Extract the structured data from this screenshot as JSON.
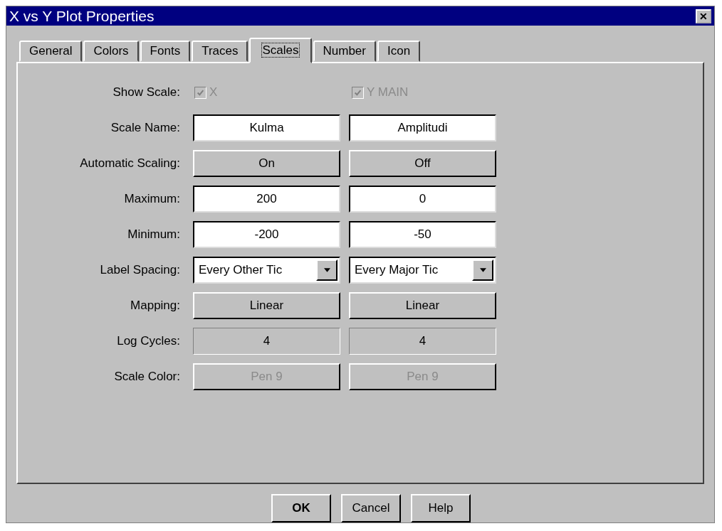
{
  "window": {
    "title": "X vs Y Plot Properties",
    "close": "✕"
  },
  "tabs": [
    {
      "label": "General",
      "selected": false
    },
    {
      "label": "Colors",
      "selected": false
    },
    {
      "label": "Fonts",
      "selected": false
    },
    {
      "label": "Traces",
      "selected": false
    },
    {
      "label": "Scales",
      "selected": true
    },
    {
      "label": "Number",
      "selected": false
    },
    {
      "label": "Icon",
      "selected": false
    }
  ],
  "rows": [
    {
      "label": "Show Scale:",
      "kind": "checkbox",
      "cells": [
        {
          "text": "X",
          "checked": true,
          "disabled": true
        },
        {
          "text": "Y MAIN",
          "checked": true,
          "disabled": true
        }
      ]
    },
    {
      "label": "Scale Name:",
      "kind": "field",
      "cells": [
        {
          "text": "Kulma",
          "disabled": false
        },
        {
          "text": "Amplitudi",
          "disabled": false
        }
      ]
    },
    {
      "label": "Automatic Scaling:",
      "kind": "button",
      "cells": [
        {
          "text": "On",
          "disabled": false
        },
        {
          "text": "Off",
          "disabled": false
        }
      ]
    },
    {
      "label": "Maximum:",
      "kind": "field",
      "cells": [
        {
          "text": "200",
          "disabled": false
        },
        {
          "text": "0",
          "disabled": false
        }
      ]
    },
    {
      "label": "Minimum:",
      "kind": "field",
      "cells": [
        {
          "text": "-200",
          "disabled": false
        },
        {
          "text": "-50",
          "disabled": false
        }
      ]
    },
    {
      "label": "Label Spacing:",
      "kind": "dropdown",
      "cells": [
        {
          "text": "Every Other Tic",
          "disabled": false
        },
        {
          "text": "Every Major Tic",
          "disabled": false
        }
      ]
    },
    {
      "label": "Mapping:",
      "kind": "button",
      "cells": [
        {
          "text": "Linear",
          "disabled": false
        },
        {
          "text": "Linear",
          "disabled": false
        }
      ]
    },
    {
      "label": "Log Cycles:",
      "kind": "field",
      "cells": [
        {
          "text": "4",
          "disabled": true
        },
        {
          "text": "4",
          "disabled": true
        }
      ]
    },
    {
      "label": "Scale Color:",
      "kind": "button",
      "cells": [
        {
          "text": "Pen 9",
          "disabled": true
        },
        {
          "text": "Pen 9",
          "disabled": true
        }
      ]
    }
  ],
  "buttons": [
    {
      "label": "OK",
      "default": true
    },
    {
      "label": "Cancel",
      "default": false
    },
    {
      "label": "Help",
      "default": false
    }
  ]
}
